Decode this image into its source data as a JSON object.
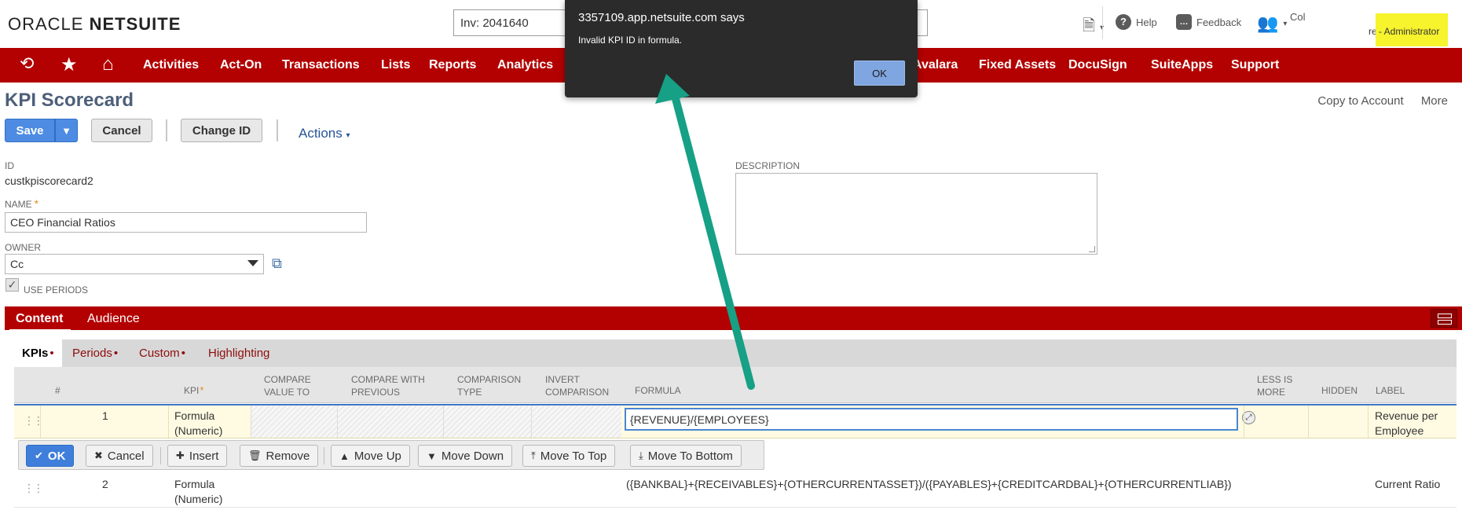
{
  "header": {
    "logo_oracle": "ORACLE",
    "logo_netsuite": "NETSUITE",
    "search_value": "Inv: 2041640",
    "help_label": "Help",
    "feedback_label": "Feedback",
    "user_label": "Col",
    "role_prefix": "re",
    "role_label": "- Administrator"
  },
  "nav": {
    "items": [
      "Activities",
      "Act-On",
      "Transactions",
      "Lists",
      "Reports",
      "Analytics",
      "Avalara",
      "Fixed Assets",
      "DocuSign",
      "SuiteApps",
      "Support"
    ]
  },
  "page": {
    "title": "KPI Scorecard",
    "copy_to_account": "Copy to Account",
    "more": "More"
  },
  "toolbar": {
    "save_label": "Save",
    "save_arrow": "▼",
    "cancel_label": "Cancel",
    "change_id_label": "Change ID",
    "actions_label": "Actions"
  },
  "form": {
    "id_label": "ID",
    "id_value": "custkpiscorecard2",
    "name_label": "NAME",
    "name_value": "CEO Financial Ratios",
    "owner_label": "OWNER",
    "owner_value": "Cc",
    "use_periods_label": "USE PERIODS",
    "description_label": "DESCRIPTION"
  },
  "subtabs": {
    "content": "Content",
    "audience": "Audience"
  },
  "innertabs": {
    "kpis": "KPIs",
    "periods": "Periods",
    "custom": "Custom",
    "highlighting": "Highlighting",
    "dot": "•"
  },
  "grid": {
    "columns": {
      "num": "#",
      "kpi": "KPI",
      "compare_value_to_1": "COMPARE",
      "compare_value_to_2": "VALUE TO",
      "compare_prev_1": "COMPARE WITH",
      "compare_prev_2": "PREVIOUS",
      "comparison_type_1": "COMPARISON",
      "comparison_type_2": "TYPE",
      "invert_1": "INVERT",
      "invert_2": "COMPARISON",
      "formula": "FORMULA",
      "less_is_more_1": "LESS IS",
      "less_is_more_2": "MORE",
      "hidden": "HIDDEN",
      "label": "LABEL"
    },
    "rows": [
      {
        "num": "1",
        "kpi_1": "Formula",
        "kpi_2": "(Numeric)",
        "formula": "{REVENUE}/{EMPLOYEES}",
        "label_1": "Revenue per",
        "label_2": "Employee"
      },
      {
        "num": "2",
        "kpi_1": "Formula",
        "kpi_2": "(Numeric)",
        "formula": "({BANKBAL}+{RECEIVABLES}+{OTHERCURRENTASSET})/({PAYABLES}+{CREDITCARDBAL}+{OTHERCURRENTLIAB})",
        "label_1": "Current Ratio",
        "label_2": ""
      }
    ],
    "row_actions": {
      "ok": "OK",
      "cancel": "Cancel",
      "insert": "Insert",
      "remove": "Remove",
      "move_up": "Move Up",
      "move_down": "Move Down",
      "move_to_top": "Move To Top",
      "move_to_bottom": "Move To Bottom"
    }
  },
  "dialog": {
    "title": "3357109.app.netsuite.com says",
    "message": "Invalid KPI ID in formula.",
    "ok_label": "OK"
  },
  "colors": {
    "nav_red": "#b30000",
    "primary_blue": "#4d8ce2",
    "annotation_arrow": "#16a085",
    "role_highlight": "#f7f32d"
  }
}
